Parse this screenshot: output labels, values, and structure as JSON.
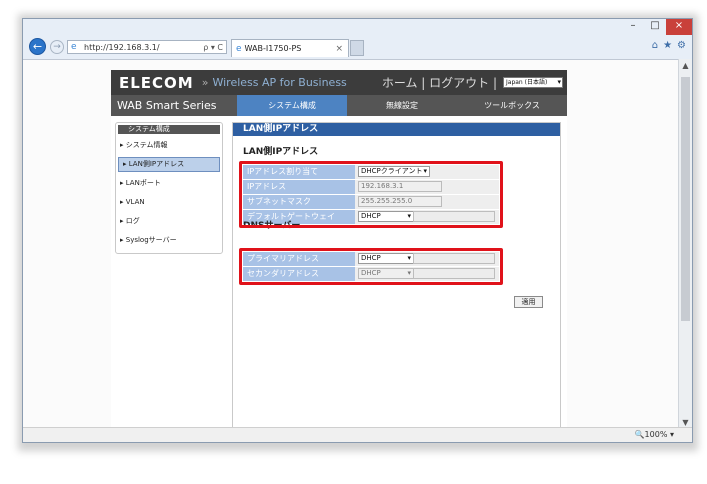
{
  "browser": {
    "url": "http://192.168.3.1/",
    "address_tools": "ρ ▾ C",
    "tab_title": "WAB-I1750-PS",
    "tab_close": "×",
    "zoom": "🔍100%",
    "zoom_arrow": "▾",
    "window_controls": [
      "–",
      "□",
      "×"
    ],
    "right_icons": [
      "⌂",
      "★",
      "⚙"
    ]
  },
  "header": {
    "logo": "ELECOM",
    "chevron": "»",
    "product": "Wireless AP for Business",
    "links": "ホーム | ログアウト |",
    "language": "Japan (日本語)"
  },
  "nav": {
    "series": "WAB Smart Series",
    "tabs": [
      "システム構成",
      "無線設定",
      "ツールボックス"
    ]
  },
  "sidebar": {
    "title": "システム構成",
    "items": [
      "システム情報",
      "LAN側IPアドレス",
      "LANポート",
      "VLAN",
      "ログ",
      "Syslogサーバー"
    ]
  },
  "main": {
    "title": "LAN側IPアドレス",
    "lan_section": "LAN側IPアドレス",
    "lan_rows": [
      {
        "label": "IPアドレス割り当て",
        "value": "DHCPクライアント"
      },
      {
        "label": "IPアドレス",
        "value": "192.168.3.1"
      },
      {
        "label": "サブネットマスク",
        "value": "255.255.255.0"
      },
      {
        "label": "デフォルトゲートウェイ",
        "value": "DHCP"
      }
    ],
    "dns_section": "DNSサーバー",
    "dns_rows": [
      {
        "label": "プライマリアドレス",
        "value": "DHCP"
      },
      {
        "label": "セカンダリアドレス",
        "value": "DHCP"
      }
    ],
    "apply_label": "適用"
  },
  "colors": {
    "accent_blue": "#2e5fa2",
    "label_blue": "#a8c2e6",
    "highlight_red": "#e0121a"
  }
}
